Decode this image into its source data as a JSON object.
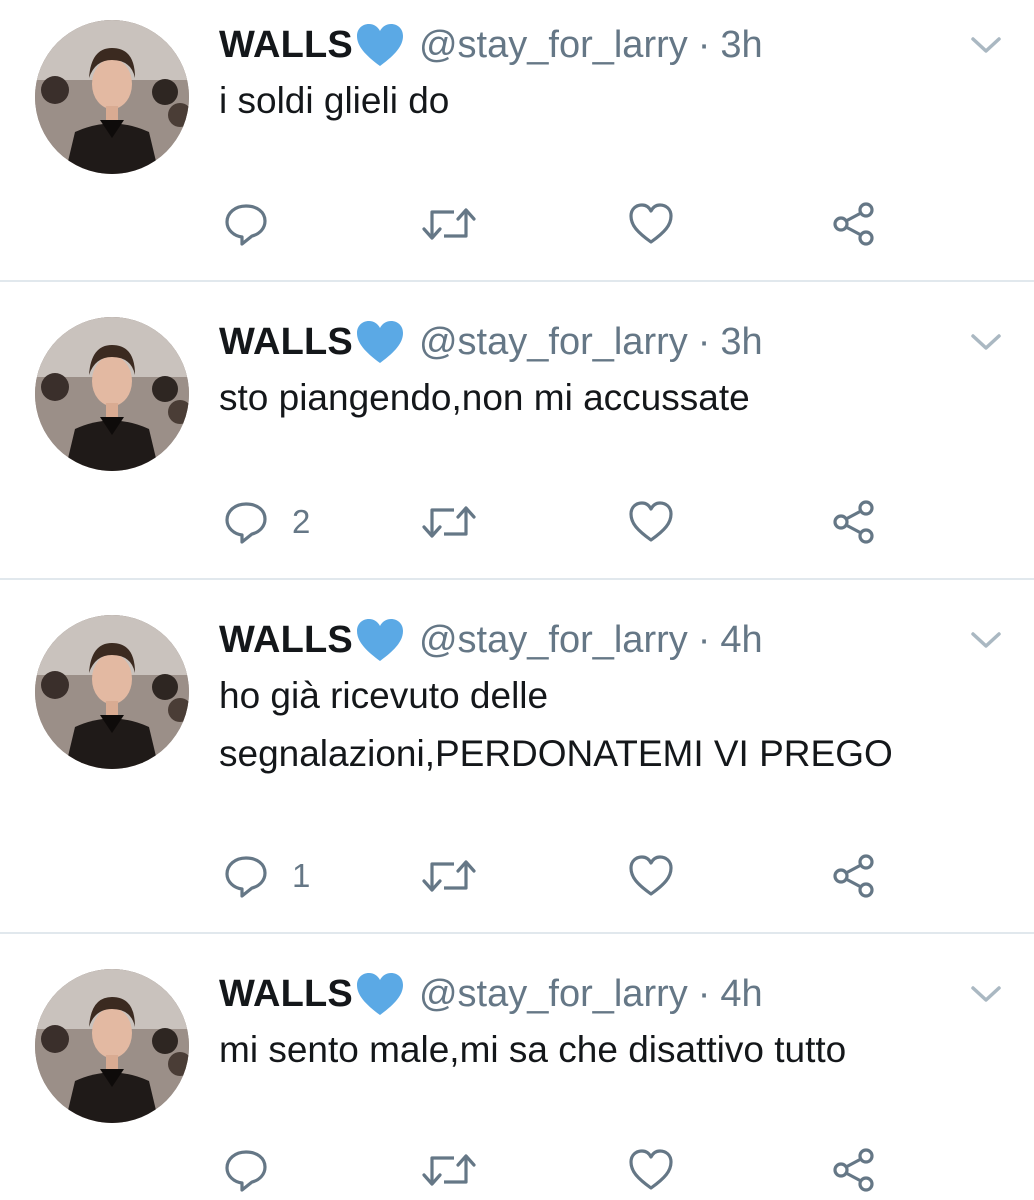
{
  "colors": {
    "text": "#14171a",
    "secondary": "#657786",
    "divider": "#e1e8ed",
    "verified_heart": "#5ba9e5",
    "icon": "#657786"
  },
  "tweets": [
    {
      "author": {
        "name": "WALLS",
        "handle": "@stay_for_larry",
        "badge_icon": "blue-heart-icon"
      },
      "separator": "·",
      "time": "3h",
      "text": "i soldi glieli do",
      "reply_count": "",
      "retweet_count": "",
      "like_count": ""
    },
    {
      "author": {
        "name": "WALLS",
        "handle": "@stay_for_larry",
        "badge_icon": "blue-heart-icon"
      },
      "separator": "·",
      "time": "3h",
      "text": "sto piangendo,non mi accussate",
      "reply_count": "2",
      "retweet_count": "",
      "like_count": ""
    },
    {
      "author": {
        "name": "WALLS",
        "handle": "@stay_for_larry",
        "badge_icon": "blue-heart-icon"
      },
      "separator": "·",
      "time": "4h",
      "text": "ho già ricevuto delle segnalazioni,PERDONATEMI VI PREGO",
      "reply_count": "1",
      "retweet_count": "",
      "like_count": ""
    },
    {
      "author": {
        "name": "WALLS",
        "handle": "@stay_for_larry",
        "badge_icon": "blue-heart-icon"
      },
      "separator": "·",
      "time": "4h",
      "text": "mi sento male,mi sa che disattivo tutto",
      "reply_count": "",
      "retweet_count": "",
      "like_count": ""
    }
  ],
  "icons": {
    "reply": "reply-icon",
    "retweet": "retweet-icon",
    "like": "like-icon",
    "share": "share-icon",
    "caret": "chevron-down-icon"
  }
}
